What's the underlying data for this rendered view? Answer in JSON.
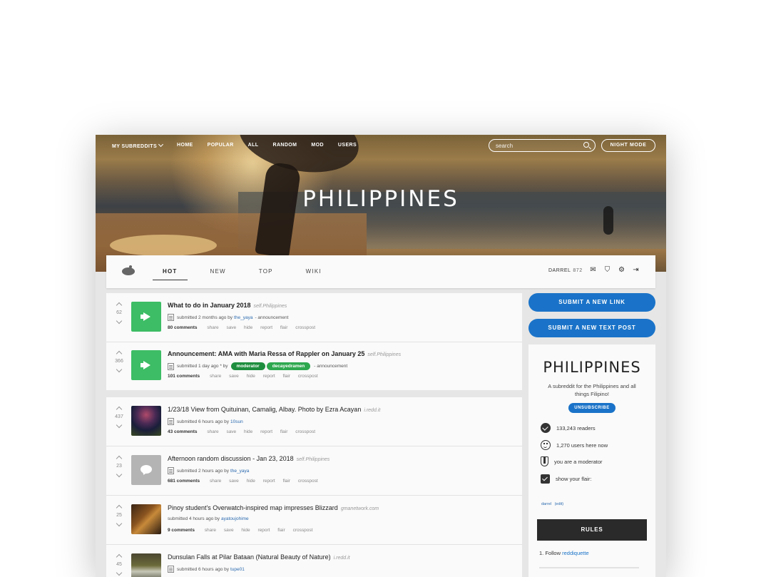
{
  "topnav": {
    "my_subreddits": "MY SUBREDDITS",
    "items": [
      "HOME",
      "POPULAR",
      "ALL",
      "RANDOM",
      "MOD",
      "USERS"
    ]
  },
  "search": {
    "placeholder": "search"
  },
  "night_mode": "NIGHT MODE",
  "subreddit_title": "PHILIPPINES",
  "tabs": [
    "HOT",
    "NEW",
    "TOP",
    "WIKI"
  ],
  "active_tab": "HOT",
  "user": {
    "name": "DARREL",
    "karma": "872"
  },
  "user_icons": [
    "mail-icon",
    "mod-shield-icon",
    "gear-icon",
    "logout-icon"
  ],
  "stickied_posts": [
    {
      "score": "62",
      "title": "What to do in January 2018",
      "domain": "self.Philippines",
      "meta_prefix": "submitted 2 months ago by",
      "author": "the_yaya",
      "meta_suffix": "- announcement",
      "comments": "80 comments",
      "thumb": "megaphone-icon"
    },
    {
      "score": "366",
      "title": "Announcement: AMA with Maria Ressa of Rappler on January 25",
      "domain": "self.Philippines",
      "meta_prefix": "submitted 1 day ago * by",
      "flair_mod": "moderator",
      "flair_user": "decayedramen",
      "meta_suffix": "- announcement",
      "comments": "101 comments",
      "thumb": "megaphone-icon"
    }
  ],
  "posts": [
    {
      "score": "437",
      "title": "1/23/18 View from Quituinan, Camalig, Albay. Photo by Ezra Acayan",
      "domain": "i.redd.it",
      "meta_prefix": "submitted 6 hours ago by",
      "author": "10sun",
      "comments": "43 comments"
    },
    {
      "score": "23",
      "title": "Afternoon random discussion - Jan 23, 2018",
      "domain": "self.Philippines",
      "meta_prefix": "submitted 2 hours ago by",
      "author": "the_yaya",
      "comments": "681 comments"
    },
    {
      "score": "25",
      "title": "Pinoy student's Overwatch-inspired map impresses Blizzard",
      "domain": "gmanetwork.com",
      "meta_prefix": "submitted 4 hours ago by",
      "author": "ayatoujohime",
      "comments": "9 comments"
    },
    {
      "score": "45",
      "title": "Dunsulan Falls at Pilar Bataan (Natural Beauty of Nature)",
      "domain": "i.redd.it",
      "meta_prefix": "submitted 6 hours ago by",
      "author": "tupe01",
      "comments": ""
    }
  ],
  "actions": [
    "share",
    "save",
    "hide",
    "report",
    "flair",
    "crosspost"
  ],
  "sidebar": {
    "submit_link": "SUBMIT A NEW LINK",
    "submit_text": "SUBMIT A NEW TEXT POST",
    "title": "PHILIPPINES",
    "description": "A subreddit for the Philippines and all things Filipino!",
    "unsubscribe": "UNSUBSCRIBE",
    "readers": "133,243 readers",
    "online": "1,270 users here now",
    "moderator": "you are a moderator",
    "show_flair": "show your flair:",
    "flair_user": "darrel",
    "flair_edit": "(edit)",
    "rules": "RULES",
    "rule1_prefix": "1. Follow",
    "rule1_link": "reddiquette"
  }
}
